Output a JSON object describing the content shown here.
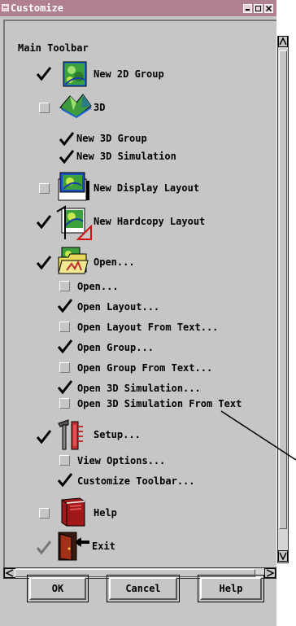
{
  "window": {
    "title": "Customize"
  },
  "section_title": "Main Toolbar",
  "items": [
    {
      "label": "New 2D Group",
      "checked": true
    },
    {
      "label": "3D",
      "checked": false
    },
    {
      "label": "New 3D Group",
      "checked": true
    },
    {
      "label": "New 3D Simulation",
      "checked": true
    },
    {
      "label": "New Display Layout",
      "checked": false
    },
    {
      "label": "New Hardcopy Layout",
      "checked": true
    },
    {
      "label": "Open...",
      "checked": true
    },
    {
      "label": "Open...",
      "checked": false
    },
    {
      "label": "Open Layout...",
      "checked": true
    },
    {
      "label": "Open Layout From Text...",
      "checked": false
    },
    {
      "label": "Open Group...",
      "checked": true
    },
    {
      "label": "Open Group From Text...",
      "checked": false
    },
    {
      "label": "Open 3D Simulation...",
      "checked": true
    },
    {
      "label": "Open 3D Simulation From Text",
      "checked": false
    },
    {
      "label": "Setup...",
      "checked": true
    },
    {
      "label": "View Options...",
      "checked": false
    },
    {
      "label": "Customize Toolbar...",
      "checked": true
    },
    {
      "label": "Help",
      "checked": false
    },
    {
      "label": "Exit",
      "checked": true
    }
  ],
  "buttons": {
    "ok": "OK",
    "cancel": "Cancel",
    "help": "Help"
  }
}
